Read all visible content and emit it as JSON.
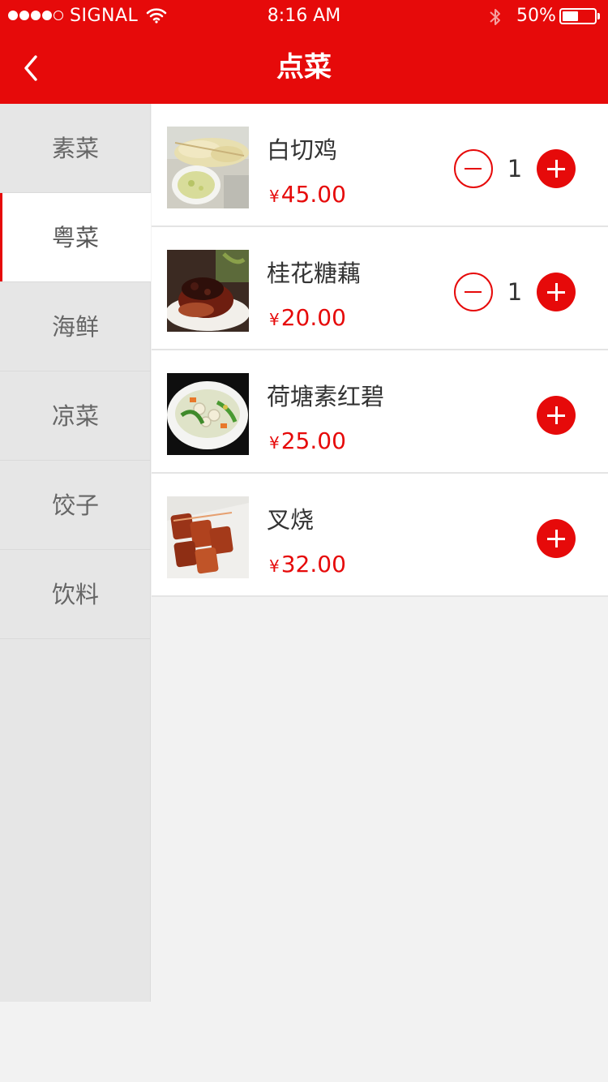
{
  "status_bar": {
    "carrier": "SIGNAL",
    "time": "8:16 AM",
    "battery": "50%",
    "battery_level": 0.5
  },
  "header": {
    "title": "点菜",
    "back_icon": "chevron-left-icon"
  },
  "categories": [
    {
      "label": "素菜",
      "active": false
    },
    {
      "label": "粤菜",
      "active": true
    },
    {
      "label": "海鲜",
      "active": false
    },
    {
      "label": "凉菜",
      "active": false
    },
    {
      "label": "饺子",
      "active": false
    },
    {
      "label": "饮料",
      "active": false
    }
  ],
  "currency_symbol": "¥",
  "dishes": [
    {
      "name": "白切鸡",
      "price": "45.00",
      "qty": "1",
      "image": "chicken-photo"
    },
    {
      "name": "桂花糖藕",
      "price": "20.00",
      "qty": "1",
      "image": "lotus-root-photo"
    },
    {
      "name": "荷塘素红碧",
      "price": "25.00",
      "qty": "",
      "image": "stir-fry-photo"
    },
    {
      "name": "叉烧",
      "price": "32.00",
      "qty": "",
      "image": "char-siu-photo"
    }
  ],
  "colors": {
    "brand_red": "#e60a0a",
    "sidebar_bg": "#e6e6e6",
    "page_bg": "#f2f2f2"
  }
}
